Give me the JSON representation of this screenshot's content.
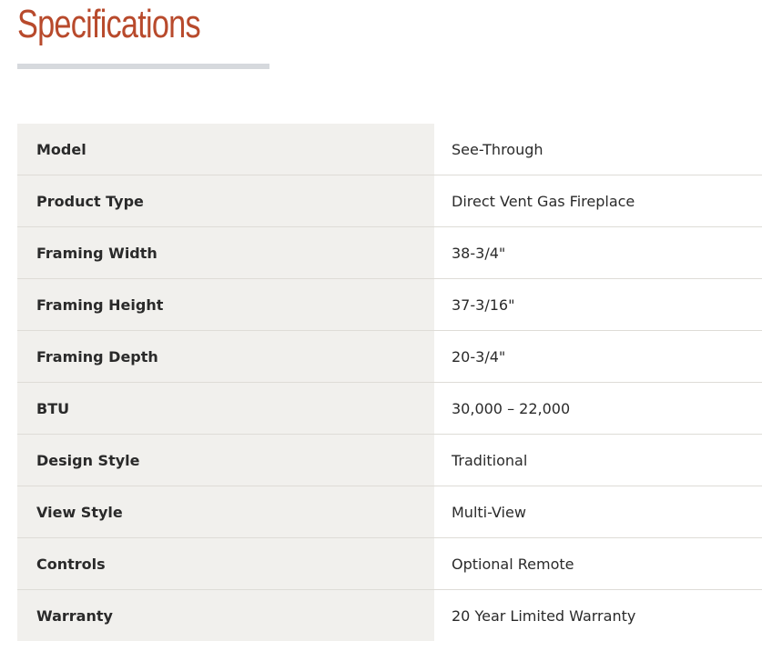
{
  "section": {
    "title": "Specifications"
  },
  "specs": [
    {
      "label": "Model",
      "value": "See-Through"
    },
    {
      "label": "Product Type",
      "value": "Direct Vent Gas Fireplace"
    },
    {
      "label": "Framing Width",
      "value": "38-3/4\""
    },
    {
      "label": "Framing Height",
      "value": "37-3/16\""
    },
    {
      "label": "Framing Depth",
      "value": "20-3/4\""
    },
    {
      "label": "BTU",
      "value": "30,000 – 22,000"
    },
    {
      "label": "Design Style",
      "value": "Traditional"
    },
    {
      "label": "View Style",
      "value": "Multi-View"
    },
    {
      "label": "Controls",
      "value": "Optional Remote"
    },
    {
      "label": "Warranty",
      "value": "20 Year Limited Warranty"
    }
  ],
  "colors": {
    "heading": "#b84a2c",
    "rule": "#d6d9dd",
    "label_bg": "#f1f0ed",
    "row_border": "#dedcd7"
  }
}
